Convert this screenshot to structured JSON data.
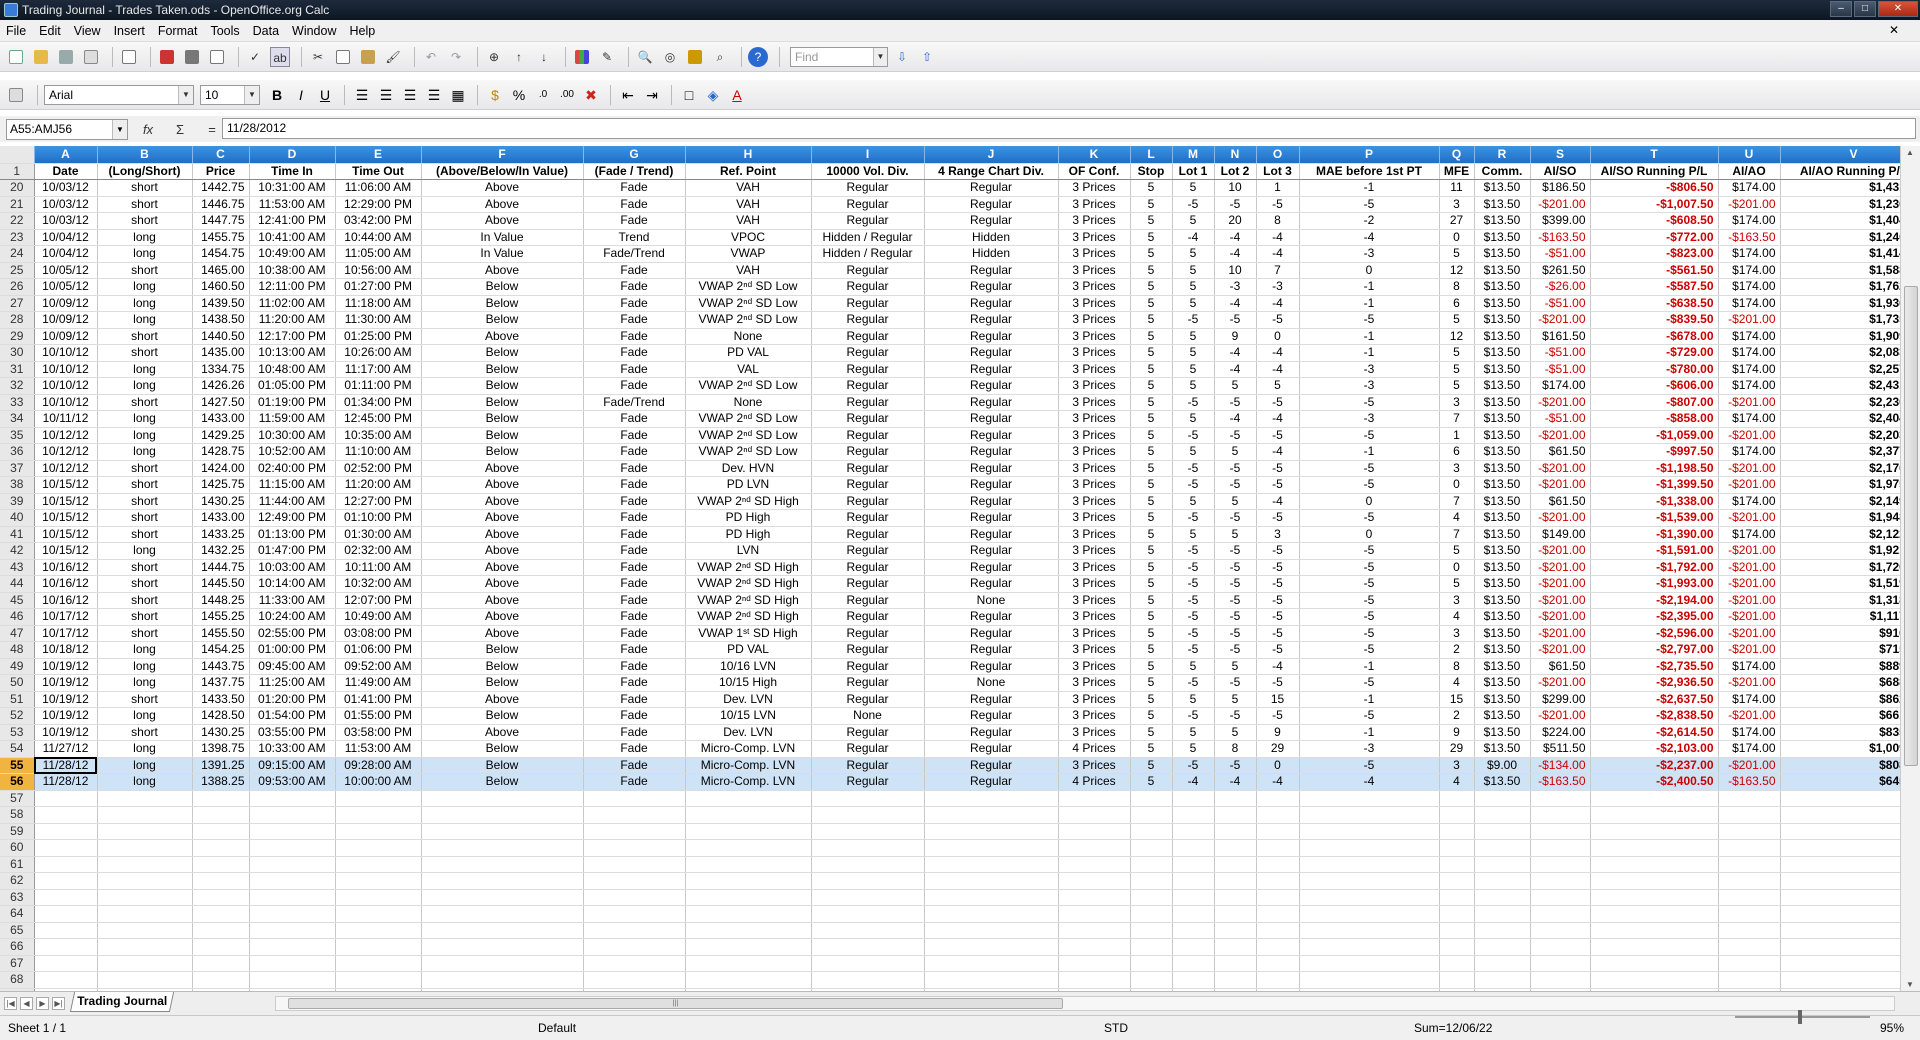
{
  "window": {
    "title": "Trading Journal - Trades Taken.ods - OpenOffice.org Calc"
  },
  "menu": [
    "File",
    "Edit",
    "View",
    "Insert",
    "Format",
    "Tools",
    "Data",
    "Window",
    "Help"
  ],
  "find": {
    "placeholder": "Find"
  },
  "font": {
    "name": "Arial",
    "size": "10"
  },
  "formula": {
    "cell_ref": "A55:AMJ56",
    "content": "11/28/2012"
  },
  "columns": [
    "A",
    "B",
    "C",
    "D",
    "E",
    "F",
    "G",
    "H",
    "I",
    "J",
    "K",
    "L",
    "M",
    "N",
    "O",
    "P",
    "Q",
    "R",
    "S",
    "T",
    "U",
    "V"
  ],
  "header": [
    "Date",
    "(Long/Short)",
    "Price",
    "Time In",
    "Time Out",
    "(Above/Below/In Value)",
    "(Fade / Trend)",
    "Ref. Point",
    "10000 Vol. Div.",
    "4 Range Chart Div.",
    "OF Conf.",
    "Stop",
    "Lot 1",
    "Lot 2",
    "Lot 3",
    "MAE before 1st PT",
    "MFE",
    "Comm.",
    "AI/SO",
    "AI/SO Running P/L",
    "AI/AO",
    "AI/AO Running P/L"
  ],
  "rows": [
    [
      "20",
      "10/03/12",
      "short",
      "1442.75",
      "10:31:00 AM",
      "11:06:00 AM",
      "Above",
      "Fade",
      "VAH",
      "Regular",
      "Regular",
      "3 Prices",
      "5",
      "5",
      "10",
      "1",
      "-1",
      "11",
      "$13.50",
      "$186.50",
      "-$806.50",
      "$174.00",
      "$1,431.00"
    ],
    [
      "21",
      "10/03/12",
      "short",
      "1446.75",
      "11:53:00 AM",
      "12:29:00 PM",
      "Above",
      "Fade",
      "VAH",
      "Regular",
      "Regular",
      "3 Prices",
      "5",
      "-5",
      "-5",
      "-5",
      "-5",
      "3",
      "$13.50",
      "-$201.00",
      "-$1,007.50",
      "-$201.00",
      "$1,230.00"
    ],
    [
      "22",
      "10/03/12",
      "short",
      "1447.75",
      "12:41:00 PM",
      "03:42:00 PM",
      "Above",
      "Fade",
      "VAH",
      "Regular",
      "Regular",
      "3 Prices",
      "5",
      "5",
      "20",
      "8",
      "-2",
      "27",
      "$13.50",
      "$399.00",
      "-$608.50",
      "$174.00",
      "$1,404.00"
    ],
    [
      "23",
      "10/04/12",
      "long",
      "1455.75",
      "10:41:00 AM",
      "10:44:00 AM",
      "In Value",
      "Trend",
      "VPOC",
      "Hidden / Regular",
      "Hidden",
      "3 Prices",
      "5",
      "-4",
      "-4",
      "-4",
      "-4",
      "0",
      "$13.50",
      "-$163.50",
      "-$772.00",
      "-$163.50",
      "$1,240.50"
    ],
    [
      "24",
      "10/04/12",
      "long",
      "1454.75",
      "10:49:00 AM",
      "11:05:00 AM",
      "In Value",
      "Fade/Trend",
      "VWAP",
      "Hidden / Regular",
      "Hidden",
      "3 Prices",
      "5",
      "5",
      "-4",
      "-4",
      "-3",
      "5",
      "$13.50",
      "-$51.00",
      "-$823.00",
      "$174.00",
      "$1,414.50"
    ],
    [
      "25",
      "10/05/12",
      "short",
      "1465.00",
      "10:38:00 AM",
      "10:56:00 AM",
      "Above",
      "Fade",
      "VAH",
      "Regular",
      "Regular",
      "3 Prices",
      "5",
      "5",
      "10",
      "7",
      "0",
      "12",
      "$13.50",
      "$261.50",
      "-$561.50",
      "$174.00",
      "$1,588.50"
    ],
    [
      "26",
      "10/05/12",
      "long",
      "1460.50",
      "12:11:00 PM",
      "01:27:00 PM",
      "Below",
      "Fade",
      "VWAP 2ⁿᵈ SD Low",
      "Regular",
      "Regular",
      "3 Prices",
      "5",
      "5",
      "-3",
      "-3",
      "-1",
      "8",
      "$13.50",
      "-$26.00",
      "-$587.50",
      "$174.00",
      "$1,762.50"
    ],
    [
      "27",
      "10/09/12",
      "long",
      "1439.50",
      "11:02:00 AM",
      "11:18:00 AM",
      "Below",
      "Fade",
      "VWAP 2ⁿᵈ SD Low",
      "Regular",
      "Regular",
      "3 Prices",
      "5",
      "5",
      "-4",
      "-4",
      "-1",
      "6",
      "$13.50",
      "-$51.00",
      "-$638.50",
      "$174.00",
      "$1,936.50"
    ],
    [
      "28",
      "10/09/12",
      "long",
      "1438.50",
      "11:20:00 AM",
      "11:30:00 AM",
      "Below",
      "Fade",
      "VWAP 2ⁿᵈ SD Low",
      "Regular",
      "Regular",
      "3 Prices",
      "5",
      "-5",
      "-5",
      "-5",
      "-5",
      "5",
      "$13.50",
      "-$201.00",
      "-$839.50",
      "-$201.00",
      "$1,735.50"
    ],
    [
      "29",
      "10/09/12",
      "short",
      "1440.50",
      "12:17:00 PM",
      "01:25:00 PM",
      "Above",
      "Fade",
      "None",
      "Regular",
      "Regular",
      "3 Prices",
      "5",
      "5",
      "9",
      "0",
      "-1",
      "12",
      "$13.50",
      "$161.50",
      "-$678.00",
      "$174.00",
      "$1,909.50"
    ],
    [
      "30",
      "10/10/12",
      "short",
      "1435.00",
      "10:13:00 AM",
      "10:26:00 AM",
      "Below",
      "Fade",
      "PD VAL",
      "Regular",
      "Regular",
      "3 Prices",
      "5",
      "5",
      "-4",
      "-4",
      "-1",
      "5",
      "$13.50",
      "-$51.00",
      "-$729.00",
      "$174.00",
      "$2,083.50"
    ],
    [
      "31",
      "10/10/12",
      "long",
      "1334.75",
      "10:48:00 AM",
      "11:17:00 AM",
      "Below",
      "Fade",
      "VAL",
      "Regular",
      "Regular",
      "3 Prices",
      "5",
      "5",
      "-4",
      "-4",
      "-3",
      "5",
      "$13.50",
      "-$51.00",
      "-$780.00",
      "$174.00",
      "$2,257.50"
    ],
    [
      "32",
      "10/10/12",
      "long",
      "1426.26",
      "01:05:00 PM",
      "01:11:00 PM",
      "Below",
      "Fade",
      "VWAP 2ⁿᵈ SD Low",
      "Regular",
      "Regular",
      "3 Prices",
      "5",
      "5",
      "5",
      "5",
      "-3",
      "5",
      "$13.50",
      "$174.00",
      "-$606.00",
      "$174.00",
      "$2,431.50"
    ],
    [
      "33",
      "10/10/12",
      "short",
      "1427.50",
      "01:19:00 PM",
      "01:34:00 PM",
      "Below",
      "Fade/Trend",
      "None",
      "Regular",
      "Regular",
      "3 Prices",
      "5",
      "-5",
      "-5",
      "-5",
      "-5",
      "3",
      "$13.50",
      "-$201.00",
      "-$807.00",
      "-$201.00",
      "$2,230.50"
    ],
    [
      "34",
      "10/11/12",
      "long",
      "1433.00",
      "11:59:00 AM",
      "12:45:00 PM",
      "Below",
      "Fade",
      "VWAP 2ⁿᵈ SD Low",
      "Regular",
      "Regular",
      "3 Prices",
      "5",
      "5",
      "-4",
      "-4",
      "-3",
      "7",
      "$13.50",
      "-$51.00",
      "-$858.00",
      "$174.00",
      "$2,404.50"
    ],
    [
      "35",
      "10/12/12",
      "long",
      "1429.25",
      "10:30:00 AM",
      "10:35:00 AM",
      "Below",
      "Fade",
      "VWAP 2ⁿᵈ SD Low",
      "Regular",
      "Regular",
      "3 Prices",
      "5",
      "-5",
      "-5",
      "-5",
      "-5",
      "1",
      "$13.50",
      "-$201.00",
      "-$1,059.00",
      "-$201.00",
      "$2,203.50"
    ],
    [
      "36",
      "10/12/12",
      "long",
      "1428.75",
      "10:52:00 AM",
      "11:10:00 AM",
      "Below",
      "Fade",
      "VWAP 2ⁿᵈ SD Low",
      "Regular",
      "Regular",
      "3 Prices",
      "5",
      "5",
      "5",
      "-4",
      "-1",
      "6",
      "$13.50",
      "$61.50",
      "-$997.50",
      "$174.00",
      "$2,377.50"
    ],
    [
      "37",
      "10/12/12",
      "short",
      "1424.00",
      "02:40:00 PM",
      "02:52:00 PM",
      "Above",
      "Fade",
      "Dev. HVN",
      "Regular",
      "Regular",
      "3 Prices",
      "5",
      "-5",
      "-5",
      "-5",
      "-5",
      "3",
      "$13.50",
      "-$201.00",
      "-$1,198.50",
      "-$201.00",
      "$2,176.50"
    ],
    [
      "38",
      "10/15/12",
      "short",
      "1425.75",
      "11:15:00 AM",
      "11:20:00 AM",
      "Above",
      "Fade",
      "PD LVN",
      "Regular",
      "Regular",
      "3 Prices",
      "5",
      "-5",
      "-5",
      "-5",
      "-5",
      "0",
      "$13.50",
      "-$201.00",
      "-$1,399.50",
      "-$201.00",
      "$1,975.50"
    ],
    [
      "39",
      "10/15/12",
      "short",
      "1430.25",
      "11:44:00 AM",
      "12:27:00 PM",
      "Above",
      "Fade",
      "VWAP 2ⁿᵈ SD High",
      "Regular",
      "Regular",
      "3 Prices",
      "5",
      "5",
      "5",
      "-4",
      "0",
      "7",
      "$13.50",
      "$61.50",
      "-$1,338.00",
      "$174.00",
      "$2,149.50"
    ],
    [
      "40",
      "10/15/12",
      "short",
      "1433.00",
      "12:49:00 PM",
      "01:10:00 PM",
      "Above",
      "Fade",
      "PD High",
      "Regular",
      "Regular",
      "3 Prices",
      "5",
      "-5",
      "-5",
      "-5",
      "-5",
      "4",
      "$13.50",
      "-$201.00",
      "-$1,539.00",
      "-$201.00",
      "$1,948.50"
    ],
    [
      "41",
      "10/15/12",
      "short",
      "1433.25",
      "01:13:00 PM",
      "01:30:00 AM",
      "Above",
      "Fade",
      "PD High",
      "Regular",
      "Regular",
      "3 Prices",
      "5",
      "5",
      "5",
      "3",
      "0",
      "7",
      "$13.50",
      "$149.00",
      "-$1,390.00",
      "$174.00",
      "$2,122.50"
    ],
    [
      "42",
      "10/15/12",
      "long",
      "1432.25",
      "01:47:00 PM",
      "02:32:00 AM",
      "Above",
      "Fade",
      "LVN",
      "Regular",
      "Regular",
      "3 Prices",
      "5",
      "-5",
      "-5",
      "-5",
      "-5",
      "5",
      "$13.50",
      "-$201.00",
      "-$1,591.00",
      "-$201.00",
      "$1,921.50"
    ],
    [
      "43",
      "10/16/12",
      "short",
      "1444.75",
      "10:03:00 AM",
      "10:11:00 AM",
      "Above",
      "Fade",
      "VWAP 2ⁿᵈ SD High",
      "Regular",
      "Regular",
      "3 Prices",
      "5",
      "-5",
      "-5",
      "-5",
      "-5",
      "0",
      "$13.50",
      "-$201.00",
      "-$1,792.00",
      "-$201.00",
      "$1,720.50"
    ],
    [
      "44",
      "10/16/12",
      "short",
      "1445.50",
      "10:14:00 AM",
      "10:32:00 AM",
      "Above",
      "Fade",
      "VWAP 2ⁿᵈ SD High",
      "Regular",
      "Regular",
      "3 Prices",
      "5",
      "-5",
      "-5",
      "-5",
      "-5",
      "5",
      "$13.50",
      "-$201.00",
      "-$1,993.00",
      "-$201.00",
      "$1,519.50"
    ],
    [
      "45",
      "10/16/12",
      "short",
      "1448.25",
      "11:33:00 AM",
      "12:07:00 PM",
      "Above",
      "Fade",
      "VWAP 2ⁿᵈ SD High",
      "Regular",
      "None",
      "3 Prices",
      "5",
      "-5",
      "-5",
      "-5",
      "-5",
      "3",
      "$13.50",
      "-$201.00",
      "-$2,194.00",
      "-$201.00",
      "$1,318.50"
    ],
    [
      "46",
      "10/17/12",
      "short",
      "1455.25",
      "10:24:00 AM",
      "10:49:00 AM",
      "Above",
      "Fade",
      "VWAP 2ⁿᵈ SD High",
      "Regular",
      "Regular",
      "3 Prices",
      "5",
      "-5",
      "-5",
      "-5",
      "-5",
      "4",
      "$13.50",
      "-$201.00",
      "-$2,395.00",
      "-$201.00",
      "$1,117.50"
    ],
    [
      "47",
      "10/17/12",
      "short",
      "1455.50",
      "02:55:00 PM",
      "03:08:00 PM",
      "Above",
      "Fade",
      "VWAP 1ˢᵗ SD High",
      "Regular",
      "Regular",
      "3 Prices",
      "5",
      "-5",
      "-5",
      "-5",
      "-5",
      "3",
      "$13.50",
      "-$201.00",
      "-$2,596.00",
      "-$201.00",
      "$916.50"
    ],
    [
      "48",
      "10/18/12",
      "long",
      "1454.25",
      "01:00:00 PM",
      "01:06:00 PM",
      "Below",
      "Fade",
      "PD VAL",
      "Regular",
      "Regular",
      "3 Prices",
      "5",
      "-5",
      "-5",
      "-5",
      "-5",
      "2",
      "$13.50",
      "-$201.00",
      "-$2,797.00",
      "-$201.00",
      "$715.50"
    ],
    [
      "49",
      "10/19/12",
      "long",
      "1443.75",
      "09:45:00 AM",
      "09:52:00 AM",
      "Below",
      "Fade",
      "10/16 LVN",
      "Regular",
      "Regular",
      "3 Prices",
      "5",
      "5",
      "5",
      "-4",
      "-1",
      "8",
      "$13.50",
      "$61.50",
      "-$2,735.50",
      "$174.00",
      "$889.50"
    ],
    [
      "50",
      "10/19/12",
      "long",
      "1437.75",
      "11:25:00 AM",
      "11:49:00 AM",
      "Below",
      "Fade",
      "10/15 High",
      "Regular",
      "None",
      "3 Prices",
      "5",
      "-5",
      "-5",
      "-5",
      "-5",
      "4",
      "$13.50",
      "-$201.00",
      "-$2,936.50",
      "-$201.00",
      "$688.50"
    ],
    [
      "51",
      "10/19/12",
      "short",
      "1433.50",
      "01:20:00 PM",
      "01:41:00 PM",
      "Above",
      "Fade",
      "Dev. LVN",
      "Regular",
      "Regular",
      "3 Prices",
      "5",
      "5",
      "5",
      "15",
      "-1",
      "15",
      "$13.50",
      "$299.00",
      "-$2,637.50",
      "$174.00",
      "$862.50"
    ],
    [
      "52",
      "10/19/12",
      "long",
      "1428.50",
      "01:54:00 PM",
      "01:55:00 PM",
      "Below",
      "Fade",
      "10/15 LVN",
      "None",
      "Regular",
      "3 Prices",
      "5",
      "-5",
      "-5",
      "-5",
      "-5",
      "2",
      "$13.50",
      "-$201.00",
      "-$2,838.50",
      "-$201.00",
      "$661.50"
    ],
    [
      "53",
      "10/19/12",
      "short",
      "1430.25",
      "03:55:00 PM",
      "03:58:00 PM",
      "Above",
      "Fade",
      "Dev. LVN",
      "Regular",
      "Regular",
      "3 Prices",
      "5",
      "5",
      "5",
      "9",
      "-1",
      "9",
      "$13.50",
      "$224.00",
      "-$2,614.50",
      "$174.00",
      "$835.50"
    ],
    [
      "54",
      "11/27/12",
      "long",
      "1398.75",
      "10:33:00 AM",
      "11:53:00 AM",
      "Below",
      "Fade",
      "Micro-Comp. LVN",
      "Regular",
      "Regular",
      "4 Prices",
      "5",
      "5",
      "8",
      "29",
      "-3",
      "29",
      "$13.50",
      "$511.50",
      "-$2,103.00",
      "$174.00",
      "$1,009.50"
    ],
    [
      "55",
      "11/28/12",
      "long",
      "1391.25",
      "09:15:00 AM",
      "09:28:00 AM",
      "Below",
      "Fade",
      "Micro-Comp. LVN",
      "Regular",
      "Regular",
      "3 Prices",
      "5",
      "-5",
      "-5",
      "0",
      "-5",
      "3",
      "$9.00",
      "-$134.00",
      "-$2,237.00",
      "-$201.00",
      "$808.50"
    ],
    [
      "56",
      "11/28/12",
      "long",
      "1388.25",
      "09:53:00 AM",
      "10:00:00 AM",
      "Below",
      "Fade",
      "Micro-Comp. LVN",
      "Regular",
      "Regular",
      "4 Prices",
      "5",
      "-4",
      "-4",
      "-4",
      "-4",
      "4",
      "$13.50",
      "-$163.50",
      "-$2,400.50",
      "-$163.50",
      "$645.00"
    ]
  ],
  "empty_rows": [
    "57",
    "58",
    "59",
    "60",
    "61",
    "62",
    "63",
    "64",
    "65",
    "66",
    "67",
    "68",
    "69"
  ],
  "header_row_num": "1",
  "sheet_tab": "Trading Journal",
  "status": {
    "sheet": "Sheet 1 / 1",
    "style": "Default",
    "mode": "STD",
    "sum": "Sum=12/06/22",
    "zoom": "95%"
  }
}
